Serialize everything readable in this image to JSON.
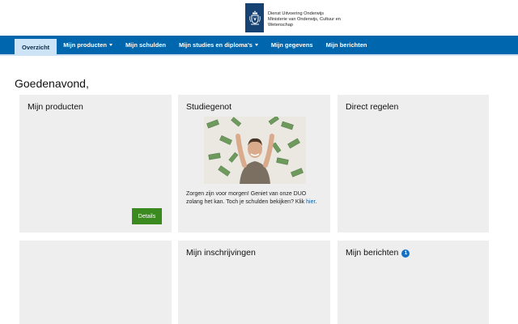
{
  "header": {
    "logo_lines": [
      "Dienst Uitvoering Onderwijs",
      "Ministerie van Onderwijs, Cultuur en",
      "Wetenschap"
    ]
  },
  "nav": {
    "items": [
      {
        "label": "Overzicht",
        "active": true,
        "dropdown": false
      },
      {
        "label": "Mijn producten",
        "active": false,
        "dropdown": true
      },
      {
        "label": "Mijn schulden",
        "active": false,
        "dropdown": false
      },
      {
        "label": "Mijn studies en diploma's",
        "active": false,
        "dropdown": true
      },
      {
        "label": "Mijn gegevens",
        "active": false,
        "dropdown": false
      },
      {
        "label": "Mijn berichten",
        "active": false,
        "dropdown": false
      }
    ]
  },
  "greeting": "Goedenavond,",
  "cards": {
    "producten": {
      "title": "Mijn producten",
      "button": "Details"
    },
    "studiegenot": {
      "title": "Studiegenot",
      "text": "Zorgen zijn voor morgen! Geniet van onze DUO zolang het kan. Toch je schulden bekijken? Klik ",
      "link": "hier",
      "text_end": "."
    },
    "direct": {
      "title": "Direct regelen"
    },
    "inschrijvingen": {
      "title": "Mijn inschrijvingen"
    },
    "berichten": {
      "title": "Mijn berichten",
      "badge": "1"
    }
  },
  "colors": {
    "nav_bg": "#0066ad",
    "nav_active_bg": "#cde4f6",
    "card_bg": "#eeeeee",
    "button_green": "#3b8a1f",
    "badge_blue": "#1670c2",
    "logo_ribbon": "#154273"
  }
}
